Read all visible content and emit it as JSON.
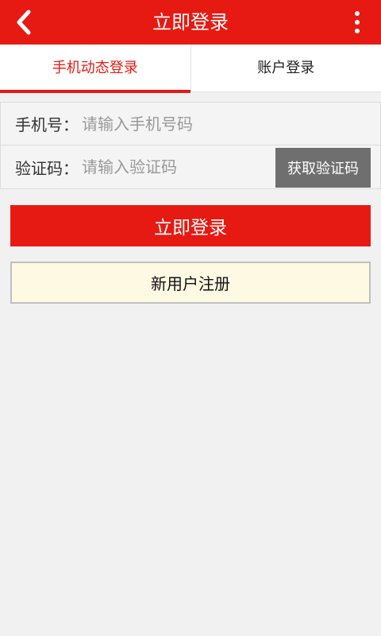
{
  "header": {
    "title": "立即登录",
    "back_icon": "chevron-left-icon",
    "more_icon": "more-vertical-icon"
  },
  "tabs": [
    {
      "label": "手机动态登录",
      "active": true
    },
    {
      "label": "账户登录",
      "active": false
    }
  ],
  "form": {
    "phone_label": "手机号：",
    "phone_placeholder": "请输入手机号码",
    "phone_value": "",
    "code_label": "验证码：",
    "code_placeholder": "请输入验证码",
    "code_value": "",
    "get_code_label": "获取验证码"
  },
  "actions": {
    "login_label": "立即登录",
    "register_label": "新用户注册"
  },
  "colors": {
    "brand_red": "#e61a12",
    "code_button_gray": "#6f6f6f",
    "register_bg": "#fdf9e3"
  }
}
